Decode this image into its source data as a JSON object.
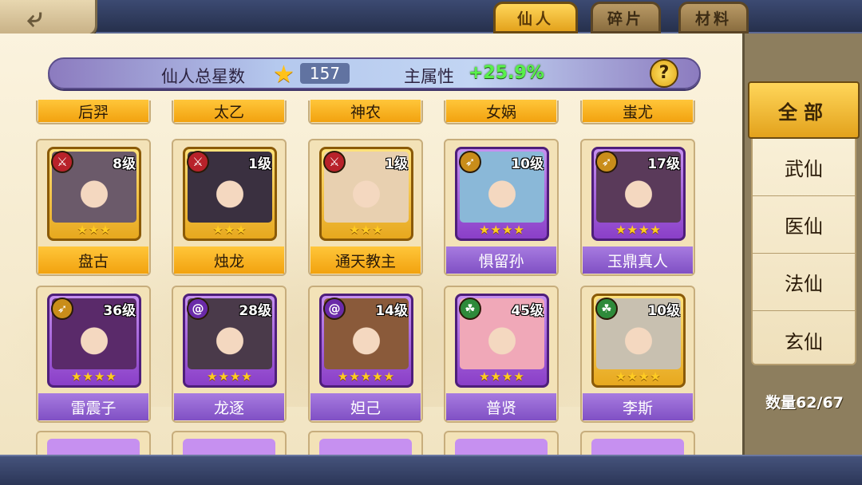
{
  "tabs": [
    {
      "label": "仙人",
      "active": true
    },
    {
      "label": "碎片",
      "active": false
    },
    {
      "label": "材料",
      "active": false
    }
  ],
  "banner": {
    "total_stars_label": "仙人总星数",
    "total_stars_value": "157",
    "main_attr_label": "主属性",
    "main_attr_value": "+25.9%",
    "help": "?"
  },
  "top_row_names": [
    "后羿",
    "太乙",
    "神农",
    "女娲",
    "蚩尤"
  ],
  "heroes": [
    {
      "name": "盘古",
      "level": "8级",
      "stars": 3,
      "frame": "gold",
      "class_icon": "sword-icon",
      "class_color": "red"
    },
    {
      "name": "烛龙",
      "level": "1级",
      "stars": 3,
      "frame": "gold",
      "class_icon": "sword-icon",
      "class_color": "red"
    },
    {
      "name": "通天教主",
      "level": "1级",
      "stars": 3,
      "frame": "gold",
      "class_icon": "sword-icon",
      "class_color": "red"
    },
    {
      "name": "惧留孙",
      "level": "10级",
      "stars": 4,
      "frame": "violet",
      "class_icon": "bow-icon",
      "class_color": "gold"
    },
    {
      "name": "玉鼎真人",
      "level": "17级",
      "stars": 4,
      "frame": "violet",
      "class_icon": "bow-icon",
      "class_color": "gold"
    },
    {
      "name": "雷震子",
      "level": "36级",
      "stars": 4,
      "frame": "violet",
      "class_icon": "bow-icon",
      "class_color": "gold"
    },
    {
      "name": "龙逐",
      "level": "28级",
      "stars": 4,
      "frame": "violet",
      "class_icon": "swirl-icon",
      "class_color": "purple"
    },
    {
      "name": "妲己",
      "level": "14级",
      "stars": 5,
      "frame": "violet",
      "class_icon": "swirl-icon",
      "class_color": "purple"
    },
    {
      "name": "普贤",
      "level": "45级",
      "stars": 4,
      "frame": "violet",
      "class_icon": "leaf-icon",
      "class_color": "green"
    },
    {
      "name": "李斯",
      "level": "10级",
      "stars": 4,
      "frame": "gold",
      "class_icon": "leaf-icon",
      "class_color": "green"
    }
  ],
  "filters": [
    "全部",
    "武仙",
    "医仙",
    "法仙",
    "玄仙"
  ],
  "quantity": "数量62/67",
  "colors": {
    "accent_gold": "#f2a20f",
    "accent_purple": "#8050c4",
    "attr_green": "#58f04a"
  }
}
